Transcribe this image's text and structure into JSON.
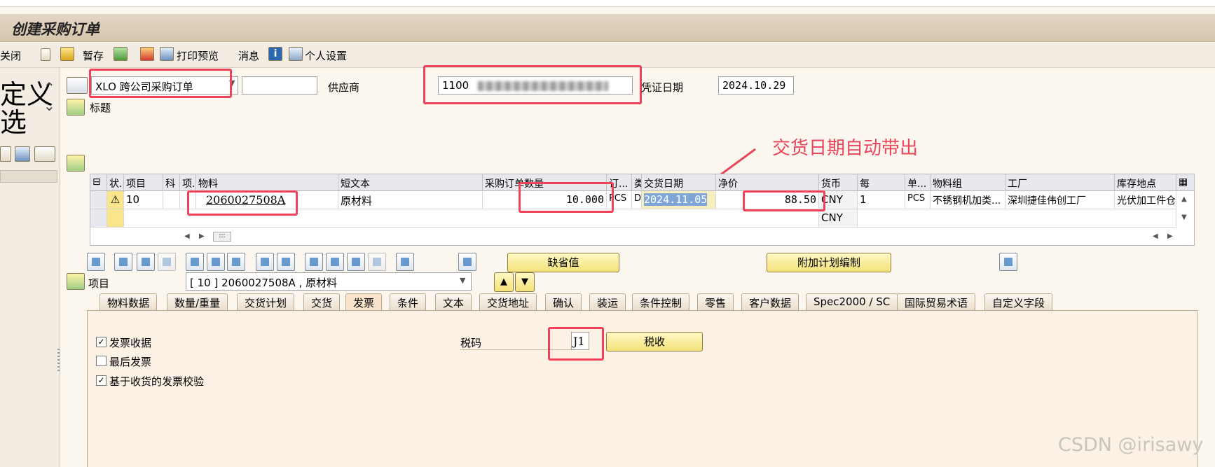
{
  "window": {
    "title": "创建采购订单"
  },
  "toolbar": {
    "close_label": "关闭",
    "hold_label": "暂存",
    "print_preview_label": "打印预览",
    "messages_label": "消息",
    "personal_settings_label": "个人设置"
  },
  "leftpanel": {
    "text": "定义\n选"
  },
  "header": {
    "order_type": "XLO 跨公司采购订单",
    "vendor_label": "供应商",
    "vendor_value": "1100",
    "doc_date_label": "凭证日期",
    "doc_date_value": "2024.10.29",
    "header_title_label": "标题"
  },
  "annotation": {
    "text": "交货日期自动带出",
    "color": "#e8455a"
  },
  "grid": {
    "columns": [
      "状.",
      "项目",
      "科",
      "项.",
      "物料",
      "短文本",
      "采购订单数量",
      "订...",
      "类",
      "交货日期",
      "净价",
      "货币",
      "每",
      "单...",
      "物料组",
      "工厂",
      "库存地点"
    ],
    "rows": [
      {
        "item": "10",
        "material": "2060027508A",
        "short_text": "原材料",
        "quantity": "10.000",
        "unit": "PCS",
        "cat": "D",
        "delivery_date": "2024.11.05",
        "net_price": "88.50",
        "currency": "CNY",
        "per": "1",
        "order_unit": "PCS",
        "mat_group": "不锈钢机加类...",
        "plant": "深圳捷佳伟创工厂",
        "storage": "光伏加工件仓"
      },
      {
        "currency": "CNY"
      }
    ]
  },
  "item_bar": {
    "default_values_label": "缺省值",
    "add_planning_label": "附加计划编制",
    "item_label": "项目",
    "item_select": "[ 10 ] 2060027508A , 原材料"
  },
  "tabs": [
    "物料数据",
    "数量/重量",
    "交货计划",
    "交货",
    "发票",
    "条件",
    "文本",
    "交货地址",
    "确认",
    "装运",
    "条件控制",
    "零售",
    "客户数据",
    "Spec2000 / SC",
    "国际贸易术语",
    "自定义字段"
  ],
  "invoice_tab": {
    "gr_invoice_label": "发票收据",
    "gr_invoice_checked": true,
    "final_invoice_label": "最后发票",
    "final_invoice_checked": false,
    "gr_based_iv_label": "基于收货的发票校验",
    "gr_based_iv_checked": true,
    "tax_code_label": "税码",
    "tax_code_value": "J1",
    "tax_button_label": "税收"
  },
  "watermark": {
    "text": "CSDN @irisawy"
  }
}
